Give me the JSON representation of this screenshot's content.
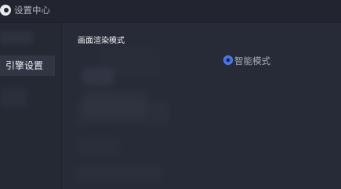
{
  "window": {
    "title": "设置中心"
  },
  "sidebar": {
    "items": [
      {
        "label": "引擎设置",
        "selected": true
      }
    ]
  },
  "main": {
    "section_title": "画面渲染模式",
    "options": [
      {
        "label": "智能模式",
        "selected": true
      }
    ]
  },
  "colors": {
    "background": "#2a2e3a",
    "accent": "#3f6fe0"
  },
  "icons": {
    "app": "app-logo-icon",
    "radio": "radio-selected-icon"
  }
}
